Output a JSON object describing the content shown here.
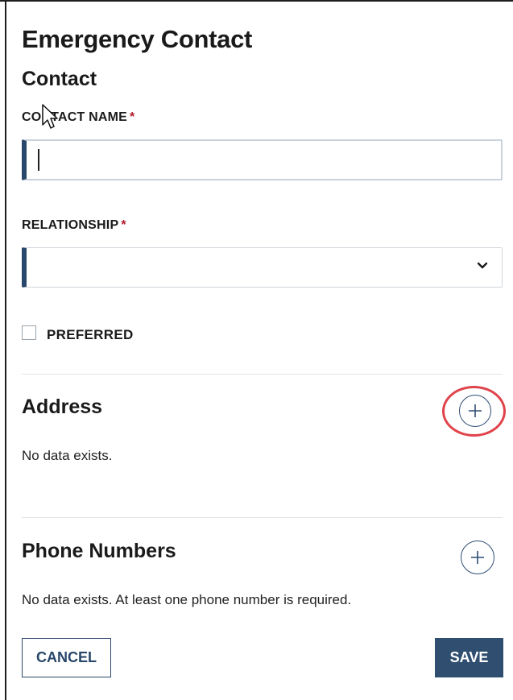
{
  "form": {
    "title": "Emergency Contact",
    "subtitle": "Contact",
    "contact_name": {
      "label": "CONTACT NAME",
      "required_mark": "*",
      "value": "",
      "placeholder": ""
    },
    "relationship": {
      "label": "RELATIONSHIP",
      "required_mark": "*",
      "selected": "",
      "icon": "chevron-down-icon"
    },
    "preferred": {
      "label": "PREFERRED",
      "checked": false
    }
  },
  "sections": {
    "address": {
      "title": "Address",
      "empty_text": "No data exists.",
      "add_icon": "plus-icon"
    },
    "phone_numbers": {
      "title": "Phone Numbers",
      "empty_text": "No data exists. At least one phone number is required.",
      "add_icon": "plus-icon"
    }
  },
  "actions": {
    "cancel_label": "CANCEL",
    "save_label": "SAVE"
  },
  "colors": {
    "accent": "#29476a",
    "required": "#b11a2b",
    "highlight": "#e0434a",
    "save_bg": "#2f4e70"
  }
}
